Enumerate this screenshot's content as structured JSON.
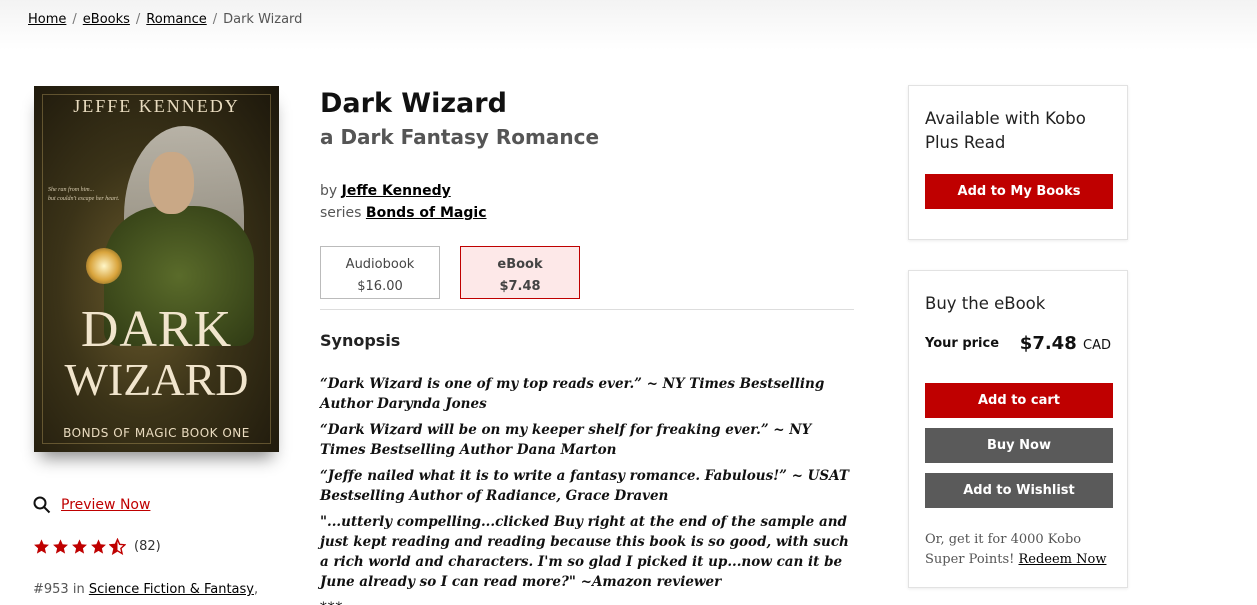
{
  "breadcrumb": {
    "items": [
      "Home",
      "eBooks",
      "Romance"
    ],
    "current": "Dark Wizard",
    "separator": "/"
  },
  "cover": {
    "author": "JEFFE KENNEDY",
    "title_line1": "DARK",
    "title_line2": "WIZARD",
    "series_line": "BONDS OF MAGIC BOOK ONE",
    "tagline_1": "She ran from him...",
    "tagline_2": "but couldn't escape her heart."
  },
  "preview": {
    "label": "Preview Now",
    "icon": "search-icon"
  },
  "rating": {
    "stars": 4.5,
    "max": 5,
    "count": "(82)",
    "color": "#bf0000"
  },
  "rank": {
    "prefix": "#953 in",
    "category": "Science Fiction & Fantasy",
    "trail": ","
  },
  "book": {
    "title": "Dark Wizard",
    "subtitle": "a Dark Fantasy Romance",
    "by_label": "by",
    "author": "Jeffe Kennedy",
    "series_label": "series",
    "series": "Bonds of Magic"
  },
  "formats": [
    {
      "name": "Audiobook",
      "price": "$16.00",
      "selected": false
    },
    {
      "name": "eBook",
      "price": "$7.48",
      "selected": true
    }
  ],
  "synopsis": {
    "heading": "Synopsis",
    "paragraphs": [
      "“Dark Wizard is one of my top reads ever.” ~ NY Times Bestselling Author Darynda Jones",
      "“Dark Wizard will be on my keeper shelf for freaking ever.” ~ NY Times Bestselling Author Dana Marton",
      "“Jeffe nailed what it is to write a fantasy romance. Fabulous!” ~ USAT Bestselling Author of Radiance, Grace Draven",
      "\"...utterly compelling...clicked Buy right at the end of the sample and just kept reading and reading because this book is so good, with such a rich world and characters. I'm so glad I picked it up...now can it be June already so I can read more?\" ~Amazon reviewer"
    ],
    "more": "***"
  },
  "kobo_plus": {
    "heading": "Available with Kobo Plus Read",
    "button": "Add to My Books"
  },
  "buy": {
    "heading": "Buy the eBook",
    "your_price_label": "Your price",
    "price": "$7.48",
    "currency": "CAD",
    "add_to_cart": "Add to cart",
    "buy_now": "Buy Now",
    "add_to_wishlist": "Add to Wishlist",
    "points_text": "Or, get it for 4000 Kobo Super Points!",
    "redeem_link": "Redeem Now"
  },
  "colors": {
    "accent": "#bf0000",
    "dark_button": "#5a5a5a",
    "selected_bg": "#fde8e8"
  }
}
